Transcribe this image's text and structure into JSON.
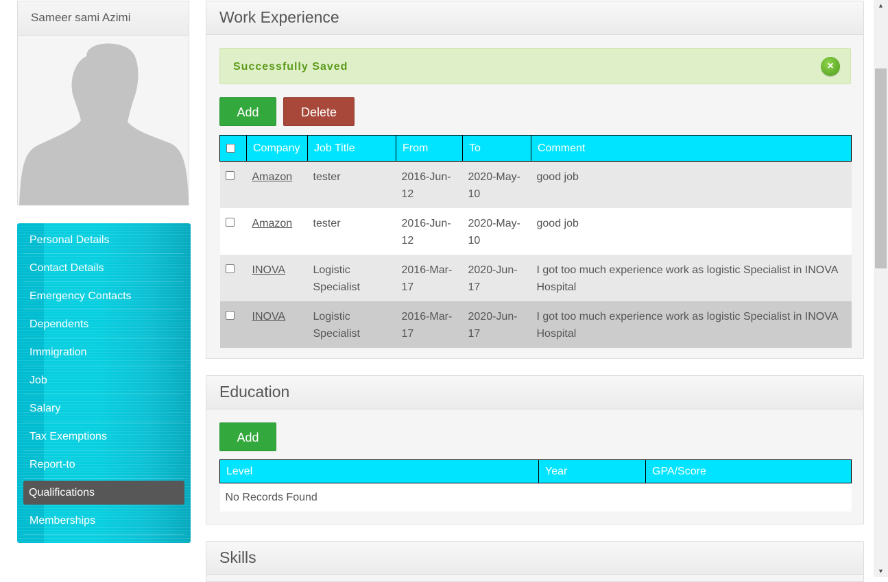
{
  "profile": {
    "name": "Sameer sami Azimi",
    "avatar_icon": "person-silhouette-icon"
  },
  "sidebar": {
    "items": [
      {
        "label": "Personal Details"
      },
      {
        "label": "Contact Details"
      },
      {
        "label": "Emergency Contacts"
      },
      {
        "label": "Dependents"
      },
      {
        "label": "Immigration"
      },
      {
        "label": "Job"
      },
      {
        "label": "Salary"
      },
      {
        "label": "Tax Exemptions"
      },
      {
        "label": "Report-to"
      },
      {
        "label": "Qualifications",
        "active": true
      },
      {
        "label": "Memberships"
      }
    ]
  },
  "work_experience": {
    "title": "Work Experience",
    "alert": {
      "message": "Successfully Saved",
      "close_icon": "close-circle-icon",
      "close_symbol": "×"
    },
    "add_label": "Add",
    "delete_label": "Delete",
    "columns": [
      "Company",
      "Job Title",
      "From",
      "To",
      "Comment"
    ],
    "rows": [
      {
        "company": "Amazon",
        "job_title": "tester",
        "from": "2016-Jun-12",
        "to": "2020-May-10",
        "comment": "good job"
      },
      {
        "company": "Amazon",
        "job_title": "tester",
        "from": "2016-Jun-12",
        "to": "2020-May-10",
        "comment": "good job"
      },
      {
        "company": "INOVA",
        "job_title": "Logistic Specialist",
        "from": "2016-Mar-17",
        "to": "2020-Jun-17",
        "comment": "I got too much experience work as logistic Specialist in INOVA Hospital"
      },
      {
        "company": "INOVA",
        "job_title": "Logistic Specialist",
        "from": "2016-Mar-17",
        "to": "2020-Jun-17",
        "comment": "I got too much experience work as logistic Specialist in INOVA Hospital"
      }
    ]
  },
  "education": {
    "title": "Education",
    "add_label": "Add",
    "columns": [
      "Level",
      "Year",
      "GPA/Score"
    ],
    "empty_text": "No Records Found"
  },
  "skills": {
    "title": "Skills"
  },
  "colors": {
    "table_header": "#00e4ff",
    "add_button": "#33a83c",
    "delete_button": "#a8483a",
    "success_bg": "#dff0c8",
    "success_text": "#5b9a1a",
    "sidebar_active": "#575757"
  },
  "scrollbar": {
    "up_icon": "scroll-up-arrow-icon",
    "down_icon": "scroll-down-arrow-icon"
  }
}
